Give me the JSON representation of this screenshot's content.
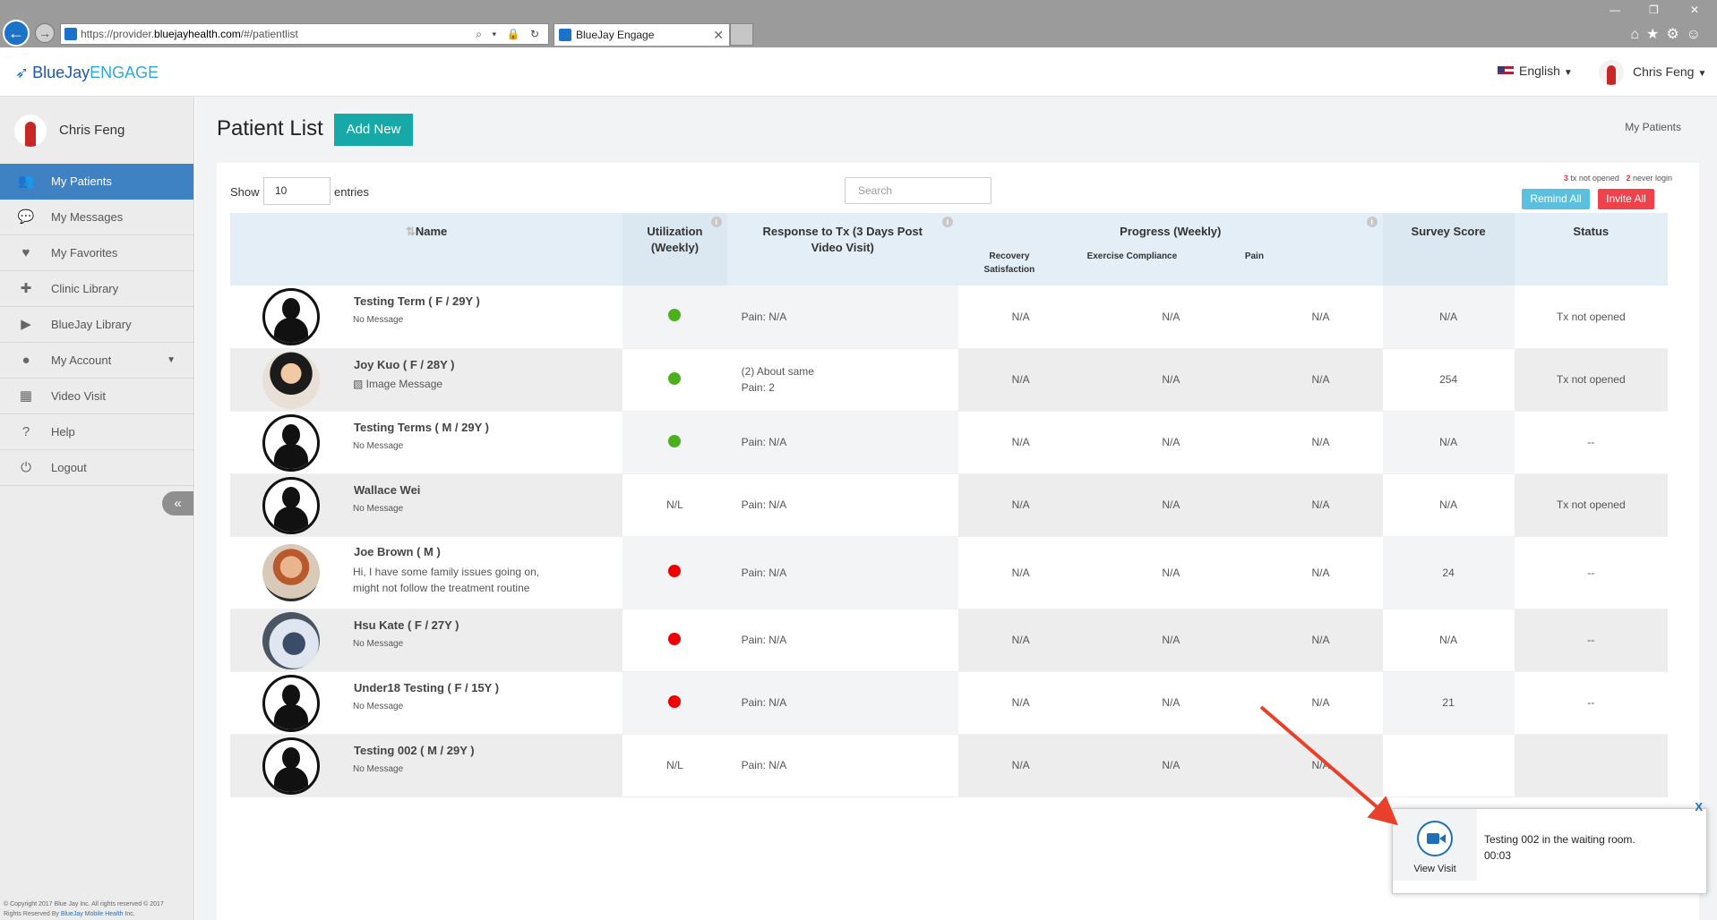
{
  "browser": {
    "url_prefix": "https://provider.",
    "url_host": "bluejayhealth.com",
    "url_suffix": "/#/patientlist",
    "url_controls": "⌕ ▾ 🔒 ↻",
    "tab_title": "BlueJay Engage",
    "tab_close": "✕",
    "min_glyph": "—",
    "restore_glyph": "❐",
    "close_glyph": "✕",
    "icons": "⌂★⚙☺"
  },
  "header": {
    "logo_main": "BlueJay",
    "logo_accent": "ENGAGE",
    "language": "English",
    "user_name": "Chris Feng"
  },
  "sidebar": {
    "user_name": "Chris Feng",
    "items": [
      {
        "label": "My Patients",
        "icon": "users-icon",
        "glyph": "👥"
      },
      {
        "label": "My Messages",
        "icon": "chat-icon",
        "glyph": "💬"
      },
      {
        "label": "My Favorites",
        "icon": "heart-icon",
        "glyph": "♥"
      },
      {
        "label": "Clinic Library",
        "icon": "clinic-icon",
        "glyph": "✚"
      },
      {
        "label": "BlueJay Library",
        "icon": "video-icon",
        "glyph": "▶"
      },
      {
        "label": "My Account",
        "icon": "account-icon",
        "glyph": "●"
      },
      {
        "label": "Video Visit",
        "icon": "calendar-icon",
        "glyph": "▦"
      },
      {
        "label": "Help",
        "icon": "help-icon",
        "glyph": "?"
      },
      {
        "label": "Logout",
        "icon": "power-icon",
        "glyph": "⏻"
      }
    ],
    "collapse_glyph": "«",
    "copyright_line1": "© Copyright 2017 Blue Jay Inc. All rights reserved © 2017",
    "copyright_line2a": "Rights Reserved By ",
    "copyright_link": "BlueJay Mobile Health",
    "copyright_line2b": " Inc."
  },
  "main": {
    "title": "Patient List",
    "add_new": "Add New",
    "breadcrumb": "My Patients",
    "show_label": "Show",
    "entries_value": "10",
    "entries_label": "entries",
    "search_placeholder": "Search",
    "stats": {
      "tx_count": "3",
      "tx_label": "tx not opened",
      "never_count": "2",
      "never_label": "never login"
    },
    "remind_all": "Remind All",
    "invite_all": "Invite All"
  },
  "table": {
    "headers": {
      "name": "Name",
      "utilization": "Utilization (Weekly)",
      "response": "Response to Tx (3 Days Post Video Visit)",
      "progress": "Progress (Weekly)",
      "recovery": "Recovery Satisfaction",
      "exercise": "Exercise Compliance",
      "pain": "Pain",
      "survey": "Survey Score",
      "status": "Status"
    },
    "rows": [
      {
        "name": "Testing Term ( F / 29Y )",
        "message": "No Message",
        "utilization": "green",
        "util_text": "",
        "response_1": "Pain: N/A",
        "response_2": "",
        "recovery": "N/A",
        "exercise": "N/A",
        "pain": "N/A",
        "survey": "N/A",
        "status": "Tx not opened"
      },
      {
        "name": "Joy Kuo ( F / 28Y )",
        "message": "▧ Image Message",
        "utilization": "green",
        "util_text": "",
        "response_1": "(2) About same",
        "response_2": "Pain: 2",
        "recovery": "N/A",
        "exercise": "N/A",
        "pain": "N/A",
        "survey": "254",
        "status": "Tx not opened"
      },
      {
        "name": "Testing Terms ( M / 29Y )",
        "message": "No Message",
        "utilization": "green",
        "util_text": "",
        "response_1": "Pain: N/A",
        "response_2": "",
        "recovery": "N/A",
        "exercise": "N/A",
        "pain": "N/A",
        "survey": "N/A",
        "status": "--"
      },
      {
        "name": "Wallace Wei",
        "message": "No Message",
        "utilization": "none",
        "util_text": "N/L",
        "response_1": "Pain: N/A",
        "response_2": "",
        "recovery": "N/A",
        "exercise": "N/A",
        "pain": "N/A",
        "survey": "N/A",
        "status": "Tx not opened"
      },
      {
        "name": "Joe Brown ( M )",
        "message": "Hi, I have some family issues going on, might not follow the treatment routine",
        "utilization": "red",
        "util_text": "",
        "response_1": "Pain: N/A",
        "response_2": "",
        "recovery": "N/A",
        "exercise": "N/A",
        "pain": "N/A",
        "survey": "24",
        "status": "--"
      },
      {
        "name": "Hsu Kate ( F / 27Y )",
        "message": "No Message",
        "utilization": "red",
        "util_text": "",
        "response_1": "Pain: N/A",
        "response_2": "",
        "recovery": "N/A",
        "exercise": "N/A",
        "pain": "N/A",
        "survey": "N/A",
        "status": "--"
      },
      {
        "name": "Under18 Testing ( F / 15Y )",
        "message": "No Message",
        "utilization": "red",
        "util_text": "",
        "response_1": "Pain: N/A",
        "response_2": "",
        "recovery": "N/A",
        "exercise": "N/A",
        "pain": "N/A",
        "survey": "21",
        "status": "--"
      },
      {
        "name": "Testing 002 ( M / 29Y )",
        "message": "No Message",
        "utilization": "none",
        "util_text": "N/L",
        "response_1": "Pain: N/A",
        "response_2": "",
        "recovery": "N/A",
        "exercise": "N/A",
        "pain": "N/A",
        "survey": "",
        "status": ""
      }
    ]
  },
  "popup": {
    "button_label": "View Visit",
    "message": "Testing 002 in the waiting room.",
    "timer": "00:03",
    "close": "X"
  },
  "colors": {
    "accent_teal": "#17a9a8",
    "active_blue": "#3e82c4",
    "status_green": "#4caf1e",
    "status_red": "#e00000",
    "annotation_arrow": "#e8402b"
  }
}
